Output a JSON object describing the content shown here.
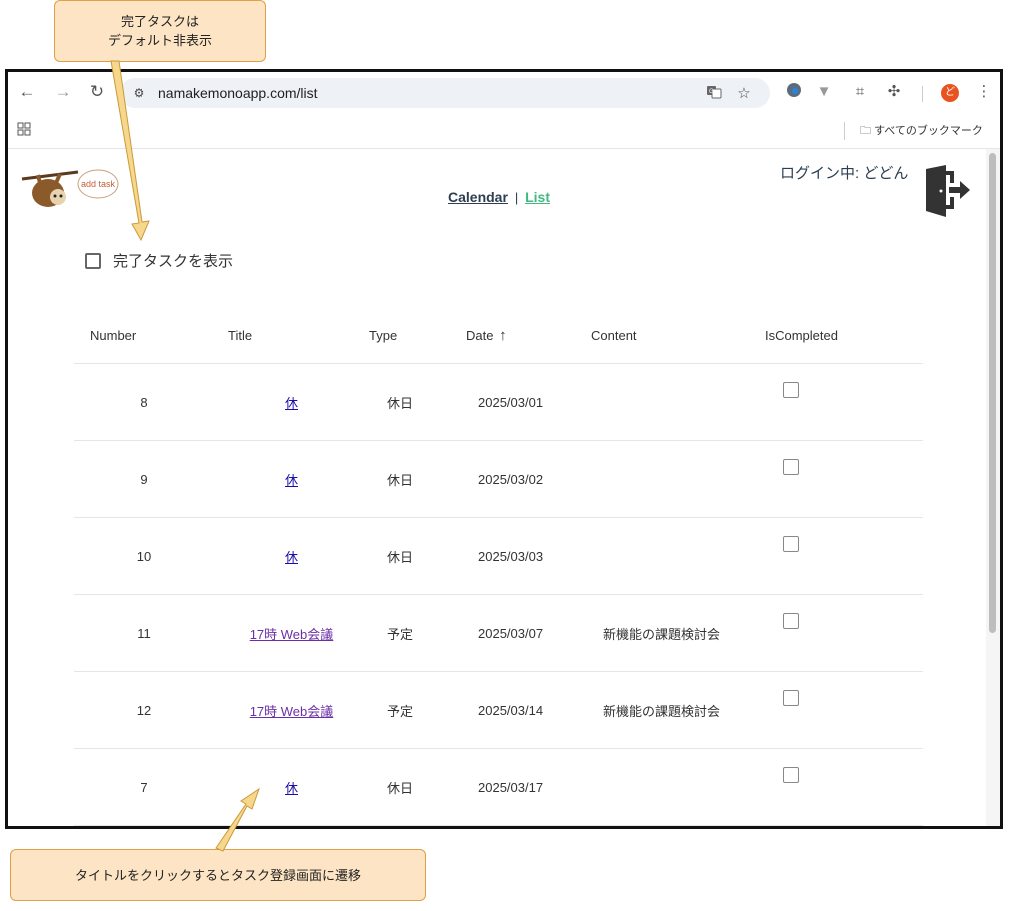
{
  "callouts": {
    "top_line1": "完了タスクは",
    "top_line2": "デフォルト非表示",
    "bottom": "タイトルをクリックするとタスク登録画面に遷移"
  },
  "browser": {
    "url": "namakemonoapp.com/list",
    "bookmarks_all": "すべてのブックマーク",
    "profile_initial": "ど"
  },
  "header": {
    "logo_bubble": "add task",
    "nav_calendar": "Calendar",
    "nav_separator": "|",
    "nav_list": "List",
    "login_status": "ログイン中: どどん"
  },
  "filter": {
    "show_completed_label": "完了タスクを表示",
    "show_completed_checked": false
  },
  "table": {
    "headers": {
      "number": "Number",
      "title": "Title",
      "type": "Type",
      "date": "Date",
      "date_sort_icon": "↑",
      "content": "Content",
      "is_completed": "IsCompleted"
    },
    "rows": [
      {
        "number": "8",
        "title": "休",
        "type": "休日",
        "date": "2025/03/01",
        "content": "",
        "completed": false
      },
      {
        "number": "9",
        "title": "休",
        "type": "休日",
        "date": "2025/03/02",
        "content": "",
        "completed": false
      },
      {
        "number": "10",
        "title": "休",
        "type": "休日",
        "date": "2025/03/03",
        "content": "",
        "completed": false
      },
      {
        "number": "11",
        "title": "17時 Web会議",
        "type": "予定",
        "date": "2025/03/07",
        "content": "新機能の課題検討会",
        "completed": false
      },
      {
        "number": "12",
        "title": "17時 Web会議",
        "type": "予定",
        "date": "2025/03/14",
        "content": "新機能の課題検討会",
        "completed": false
      },
      {
        "number": "7",
        "title": "休",
        "type": "休日",
        "date": "2025/03/17",
        "content": "",
        "completed": false
      }
    ]
  },
  "colors": {
    "nav_dark": "#2c3e50",
    "nav_active": "#42b983",
    "callout_bg": "#fde4c4",
    "callout_border": "#e0a045"
  }
}
